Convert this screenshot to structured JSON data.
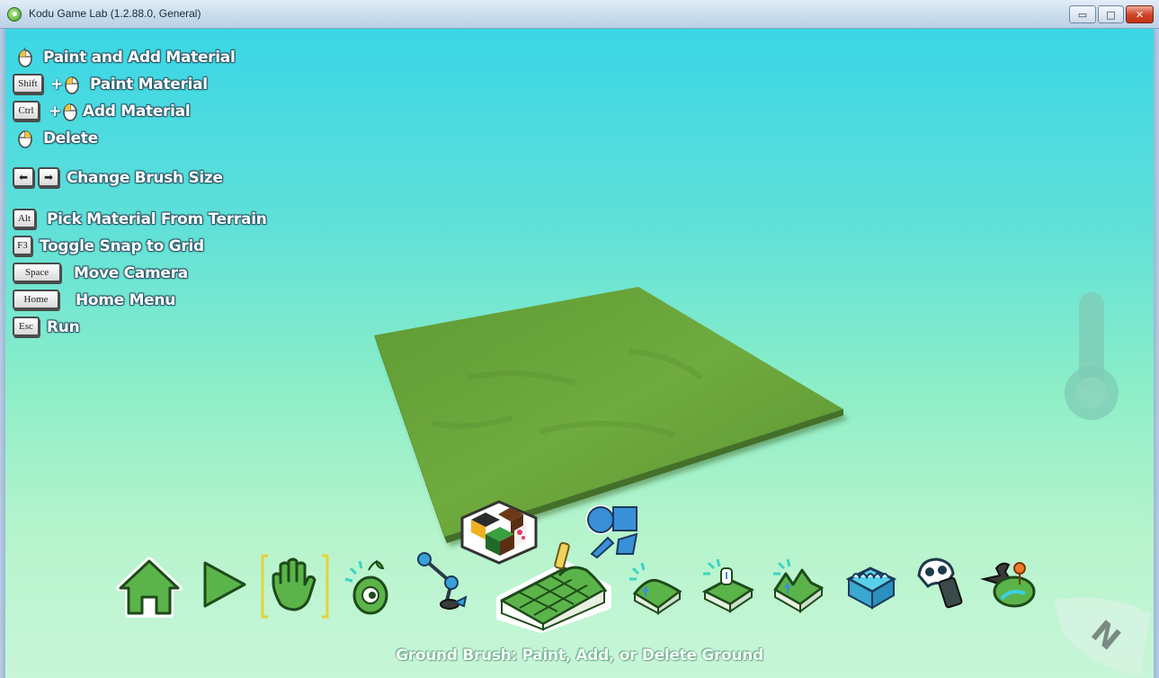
{
  "window": {
    "title": "Kodu Game Lab (1.2.88.0, General)",
    "minimize_glyph": "▭",
    "maximize_glyph": "□",
    "close_glyph": "✕"
  },
  "help": {
    "paint_add": "Paint and Add Material",
    "paint": "Paint Material",
    "add": "Add Material",
    "delete": "Delete",
    "brush_size": "Change Brush Size",
    "pick": "Pick Material From Terrain",
    "snap": "Toggle Snap to Grid",
    "camera": "Move Camera",
    "home": "Home Menu",
    "run": "Run",
    "plus": "+",
    "keys": {
      "shift": "Shift",
      "ctrl": "Ctrl",
      "alt": "Alt",
      "f3": "F3",
      "space": "Space",
      "home": "Home",
      "esc": "Esc"
    }
  },
  "toolbar": {
    "items": [
      "home-icon",
      "play-icon",
      "hand-icon",
      "object-tool-icon",
      "path-tool-icon",
      "ground-brush-icon",
      "hill-up-icon",
      "smooth-icon",
      "roughen-icon",
      "water-icon",
      "eraser-icon",
      "world-settings-icon"
    ],
    "selected": "ground-brush-icon",
    "material_picker": "material-picker-icon",
    "brush_shape_picker": "brush-shape-icon"
  },
  "status": {
    "text": "Ground Brush: Paint, Add, or Delete Ground"
  },
  "compass": {
    "letter": "N"
  },
  "colors": {
    "sky_top": "#3ad6e6",
    "sky_bottom": "#c8f6d8",
    "grass": "#6aa43a",
    "toolbar_green": "#4ea83a"
  }
}
